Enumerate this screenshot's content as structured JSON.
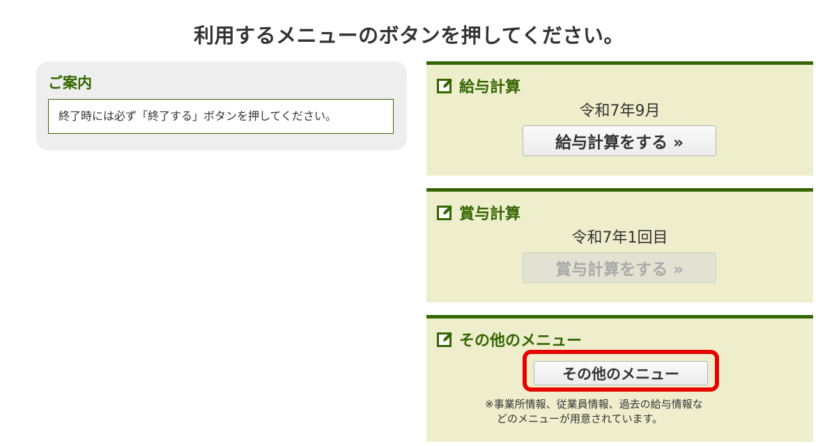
{
  "page": {
    "title": "利用するメニューのボタンを押してください。"
  },
  "info": {
    "title": "ご案内",
    "message": "終了時には必ず「終了する」ボタンを押してください。"
  },
  "panels": {
    "salary": {
      "icon": "edit-icon",
      "title": "給与計算",
      "period": "令和7年9月",
      "button_label": "給与計算をする »"
    },
    "bonus": {
      "icon": "edit-icon",
      "title": "賞与計算",
      "period": "令和7年1回目",
      "button_label": "賞与計算をする »"
    },
    "other": {
      "icon": "edit-icon",
      "title": "その他のメニュー",
      "button_label": "その他のメニュー",
      "note_line1": "※事業所情報、従業員情報、過去の給与情報な",
      "note_line2": "どのメニューが用意されています。"
    }
  },
  "colors": {
    "accent_green": "#336600",
    "panel_bg": "#eeeecc",
    "info_bg": "#eeeeee",
    "highlight_red": "#e60000"
  }
}
